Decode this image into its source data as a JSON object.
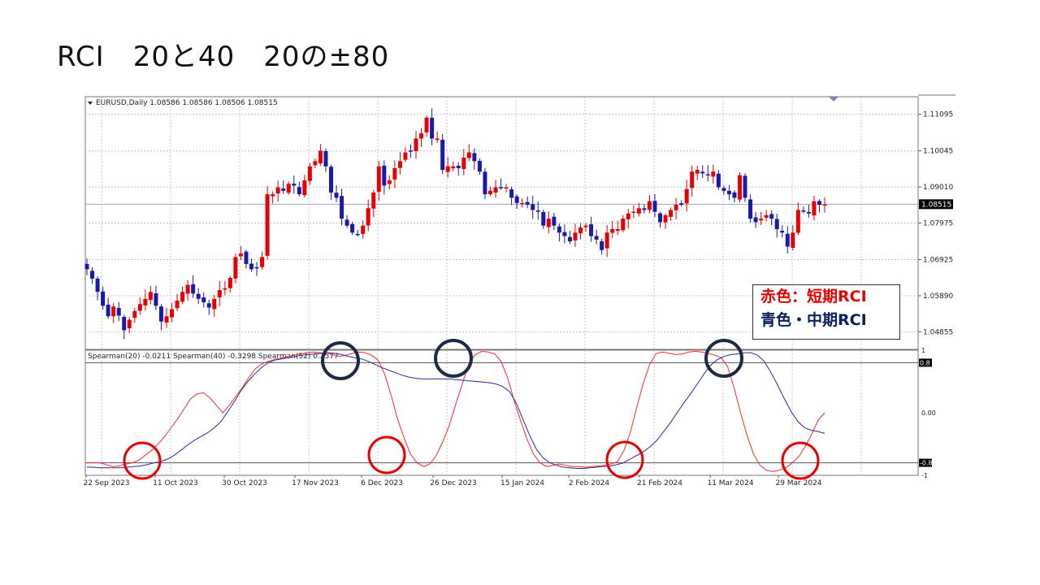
{
  "slide": {
    "title": "RCI　20と40　20の±80"
  },
  "chart_data": [
    {
      "type": "candlestick",
      "header": "EURUSD,Daily  1.08586 1.08586 1.08506 1.08515",
      "ylim": [
        1.0435,
        1.116
      ],
      "yticks": [
        "1.11095",
        "1.10045",
        "1.09010",
        "1.07975",
        "1.06925",
        "1.05890",
        "1.04855"
      ],
      "last_price_label": "1.08515",
      "last_price": 1.08515,
      "colors": {
        "up": "#e60000",
        "down": "#1a1aa8"
      },
      "close": [
        1.0665,
        1.0638,
        1.06,
        1.056,
        1.053,
        1.0558,
        1.0532,
        1.049,
        1.052,
        1.0545,
        1.0565,
        1.058,
        1.06,
        1.056,
        1.0515,
        1.053,
        1.055,
        1.0575,
        1.06,
        1.062,
        1.0595,
        1.058,
        1.057,
        1.0555,
        1.058,
        1.0605,
        1.061,
        1.064,
        1.07,
        1.071,
        1.068,
        1.0665,
        1.067,
        1.07,
        1.088,
        1.088,
        1.09,
        1.089,
        1.091,
        1.0905,
        1.088,
        1.092,
        1.096,
        1.0975,
        1.1005,
        1.096,
        1.0885,
        1.087,
        1.081,
        1.079,
        1.077,
        1.0765,
        1.079,
        1.084,
        1.0885,
        1.096,
        1.0905,
        1.092,
        1.0955,
        1.0975,
        1.1,
        1.1005,
        1.104,
        1.1055,
        1.11,
        1.104,
        1.104,
        1.095,
        1.096,
        1.096,
        1.0955,
        1.0985,
        1.1,
        1.0975,
        1.0945,
        1.088,
        1.089,
        1.09,
        1.09,
        1.09,
        1.087,
        1.0855,
        1.0855,
        1.085,
        1.0835,
        1.083,
        1.079,
        1.081,
        1.079,
        1.077,
        1.076,
        1.0745,
        1.077,
        1.0785,
        1.079,
        1.076,
        1.075,
        1.072,
        1.077,
        1.078,
        1.078,
        1.081,
        1.0825,
        1.083,
        1.084,
        1.0835,
        1.086,
        1.083,
        1.08,
        1.082,
        1.0835,
        1.085,
        1.085,
        1.0895,
        1.0945,
        1.095,
        1.094,
        1.0935,
        1.0945,
        1.09,
        1.089,
        1.088,
        1.087,
        1.0935,
        1.087,
        1.081,
        1.08,
        1.081,
        1.082,
        1.081,
        1.078,
        1.077,
        1.073,
        1.077,
        1.0835,
        1.083,
        1.0825,
        1.086,
        1.085,
        1.0851
      ]
    },
    {
      "type": "line",
      "header": "Spearman(20) -0.0211  Spearman(40) -0.3298  Spearman(52) 0.2577",
      "ylim": [
        -1,
        1
      ],
      "yticks": [
        "1",
        "0.8",
        "0.00",
        "-0.8",
        "-1"
      ],
      "hlines": [
        0.8,
        -0.8
      ],
      "x_labels": [
        "22 Sep 2023",
        "11 Oct 2023",
        "30 Oct 2023",
        "17 Nov 2023",
        "6 Dec 2023",
        "26 Dec 2023",
        "15 Jan 2024",
        "2 Feb 2024",
        "21 Feb 2024",
        "11 Mar 2024",
        "29 Mar 2024"
      ],
      "series": [
        {
          "color": "#ff2a2a",
          "values": [
            -0.8,
            -0.8,
            -0.8,
            -0.83,
            -0.86,
            -0.85,
            -0.82,
            -0.8,
            -0.76,
            -0.68,
            -0.6,
            -0.5,
            -0.38,
            -0.24,
            -0.1,
            0.06,
            0.22,
            0.3,
            0.32,
            0.24,
            0.12,
            0.0,
            0.12,
            0.26,
            0.4,
            0.56,
            0.7,
            0.78,
            0.82,
            0.85,
            0.87,
            0.9,
            0.92,
            0.94,
            0.96,
            0.97,
            0.96,
            0.95,
            0.93,
            0.9,
            0.92,
            0.95,
            0.97,
            0.96,
            0.92,
            0.84,
            0.62,
            0.28,
            -0.1,
            -0.4,
            -0.66,
            -0.8,
            -0.86,
            -0.82,
            -0.68,
            -0.46,
            -0.2,
            0.14,
            0.46,
            0.78,
            0.93,
            0.98,
            0.97,
            0.94,
            0.82,
            0.56,
            0.2,
            -0.12,
            -0.42,
            -0.66,
            -0.8,
            -0.86,
            -0.84,
            -0.82,
            -0.84,
            -0.86,
            -0.86,
            -0.87,
            -0.86,
            -0.85,
            -0.84,
            -0.82,
            -0.78,
            -0.6,
            -0.3,
            0.1,
            0.48,
            0.78,
            0.95,
            0.97,
            0.95,
            0.93,
            0.94,
            0.97,
            0.98,
            0.97,
            0.95,
            0.92,
            0.88,
            0.74,
            0.4,
            0.0,
            -0.36,
            -0.66,
            -0.84,
            -0.92,
            -0.94,
            -0.92,
            -0.88,
            -0.8,
            -0.7,
            -0.54,
            -0.34,
            -0.12,
            0.0
          ]
        },
        {
          "color": "#2a2a9e",
          "values": [
            -0.87,
            -0.87,
            -0.88,
            -0.88,
            -0.88,
            -0.88,
            -0.87,
            -0.86,
            -0.85,
            -0.83,
            -0.8,
            -0.78,
            -0.74,
            -0.68,
            -0.6,
            -0.52,
            -0.44,
            -0.38,
            -0.32,
            -0.24,
            -0.14,
            0.02,
            0.18,
            0.36,
            0.5,
            0.62,
            0.72,
            0.8,
            0.84,
            0.86,
            0.88,
            0.9,
            0.92,
            0.93,
            0.94,
            0.95,
            0.96,
            0.95,
            0.93,
            0.9,
            0.88,
            0.86,
            0.82,
            0.77,
            0.72,
            0.68,
            0.64,
            0.6,
            0.57,
            0.55,
            0.54,
            0.54,
            0.54,
            0.54,
            0.54,
            0.53,
            0.52,
            0.51,
            0.5,
            0.49,
            0.48,
            0.46,
            0.42,
            0.34,
            0.16,
            -0.1,
            -0.36,
            -0.58,
            -0.72,
            -0.8,
            -0.84,
            -0.87,
            -0.88,
            -0.89,
            -0.89,
            -0.88,
            -0.87,
            -0.86,
            -0.85,
            -0.83,
            -0.8,
            -0.74,
            -0.68,
            -0.62,
            -0.54,
            -0.44,
            -0.3,
            -0.16,
            0.0,
            0.16,
            0.3,
            0.46,
            0.62,
            0.76,
            0.85,
            0.9,
            0.93,
            0.94,
            0.96,
            0.96,
            0.92,
            0.82,
            0.64,
            0.44,
            0.22,
            0.02,
            -0.14,
            -0.24,
            -0.28,
            -0.3,
            -0.33
          ]
        }
      ]
    }
  ],
  "annotations": {
    "legend": {
      "short": "赤色：短期RCI",
      "mid": "青色・中期RCI",
      "short_color": "#e60000",
      "mid_color": "#0b1f5c"
    },
    "circle_colors": {
      "top": "#1c2a44",
      "bottom": "#e60000"
    }
  }
}
